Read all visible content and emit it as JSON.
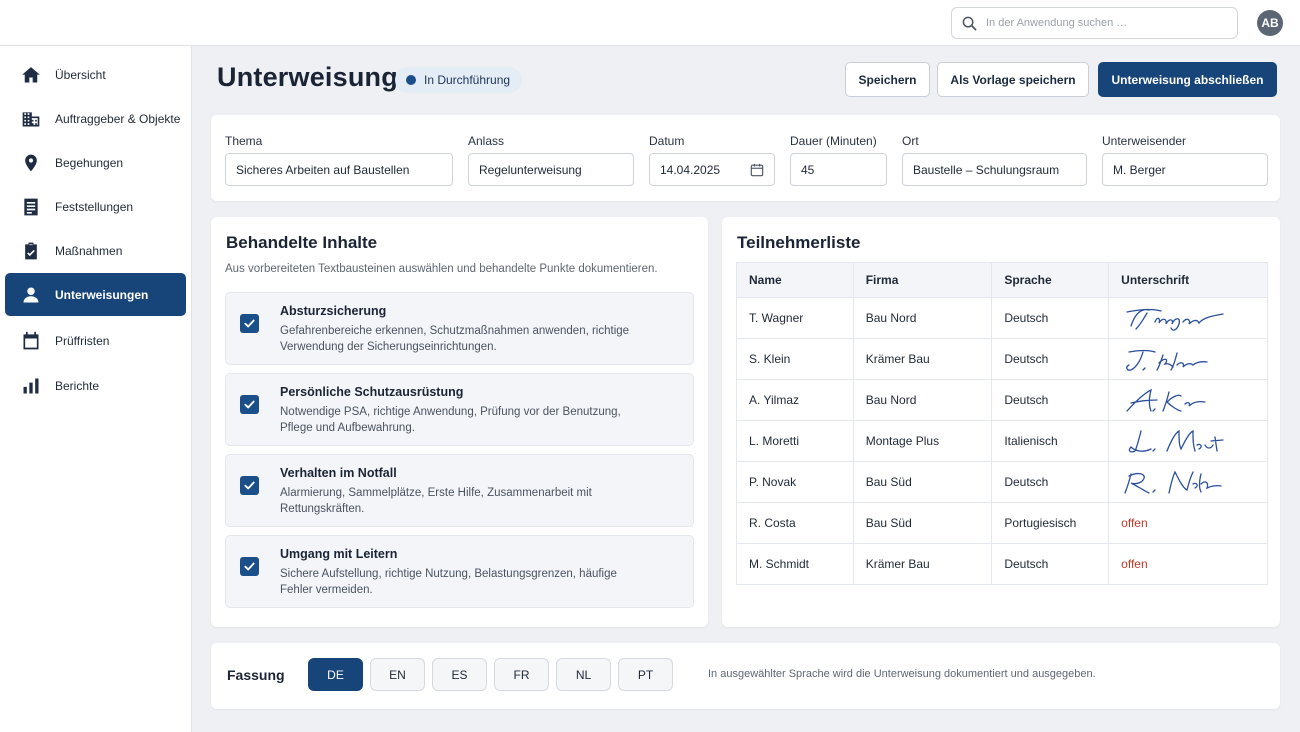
{
  "search": {
    "placeholder": "In der Anwendung suchen …"
  },
  "user": {
    "initials": "AB"
  },
  "sidebar": {
    "items": [
      {
        "label": "Übersicht",
        "icon": "home-icon"
      },
      {
        "label": "Auftraggeber & Objekte",
        "icon": "building-icon"
      },
      {
        "label": "Begehungen",
        "icon": "location-pin-icon"
      },
      {
        "label": "Feststellungen",
        "icon": "document-icon"
      },
      {
        "label": "Maßnahmen",
        "icon": "clipboard-check-icon"
      },
      {
        "label": "Unterweisungen",
        "icon": "person-icon",
        "active": true
      },
      {
        "label": "Prüffristen",
        "icon": "calendar-icon"
      },
      {
        "label": "Berichte",
        "icon": "bar-chart-icon"
      }
    ]
  },
  "header": {
    "title": "Unterweisung",
    "status": "In Durchführung",
    "save_label": "Speichern",
    "template_label": "Als Vorlage speichern",
    "finish_label": "Unterweisung abschließen"
  },
  "form": {
    "thema": {
      "label": "Thema",
      "value": "Sicheres Arbeiten auf Baustellen"
    },
    "anlass": {
      "label": "Anlass",
      "value": "Regelunterweisung"
    },
    "datum": {
      "label": "Datum",
      "value": "14.04.2025"
    },
    "dauer": {
      "label": "Dauer (Minuten)",
      "value": "45"
    },
    "ort": {
      "label": "Ort",
      "value": "Baustelle – Schulungsraum"
    },
    "unterweisender": {
      "label": "Unterweisender",
      "value": "M. Berger"
    }
  },
  "contents": {
    "title": "Behandelte Inhalte",
    "subtitle": "Aus vorbereiteten Textbausteinen auswählen und behandelte Punkte dokumentieren.",
    "topics": [
      {
        "title": "Absturzsicherung",
        "desc": "Gefahrenbereiche erkennen, Schutzmaßnahmen anwenden, richtige Verwendung der Sicherungseinrichtungen.",
        "checked": true
      },
      {
        "title": "Persönliche Schutzausrüstung",
        "desc": "Notwendige PSA, richtige Anwendung, Prüfung vor der Benutzung, Pflege und Aufbewahrung.",
        "checked": true
      },
      {
        "title": "Verhalten im Notfall",
        "desc": "Alarmierung, Sammelplätze, Erste Hilfe, Zusammenarbeit mit Rettungskräften.",
        "checked": true
      },
      {
        "title": "Umgang mit Leitern",
        "desc": "Sichere Aufstellung, richtige Nutzung, Belastungsgrenzen, häufige Fehler vermeiden.",
        "checked": true
      }
    ]
  },
  "participants": {
    "title": "Teilnehmerliste",
    "columns": [
      "Name",
      "Firma",
      "Sprache",
      "Unterschrift"
    ],
    "rows": [
      {
        "name": "T. Wagner",
        "firma": "Bau Nord",
        "sprache": "Deutsch",
        "signed": true
      },
      {
        "name": "S. Klein",
        "firma": "Krämer Bau",
        "sprache": "Deutsch",
        "signed": true
      },
      {
        "name": "A. Yilmaz",
        "firma": "Bau Nord",
        "sprache": "Deutsch",
        "signed": true
      },
      {
        "name": "L. Moretti",
        "firma": "Montage Plus",
        "sprache": "Italienisch",
        "signed": true
      },
      {
        "name": "P. Novak",
        "firma": "Bau Süd",
        "sprache": "Deutsch",
        "signed": true
      },
      {
        "name": "R. Costa",
        "firma": "Bau Süd",
        "sprache": "Portugiesisch",
        "signed": false,
        "status": "offen"
      },
      {
        "name": "M. Schmidt",
        "firma": "Krämer Bau",
        "sprache": "Deutsch",
        "signed": false,
        "status": "offen"
      }
    ]
  },
  "language": {
    "title": "Fassung",
    "options": [
      "DE",
      "EN",
      "ES",
      "FR",
      "NL",
      "PT"
    ],
    "selected": "DE",
    "hint": "In ausgewählter Sprache wird die Unterweisung dokumentiert und ausgegeben."
  },
  "colors": {
    "primary": "#17457a",
    "open_status": "#c0392b",
    "signature_ink": "#2a4f9c"
  }
}
